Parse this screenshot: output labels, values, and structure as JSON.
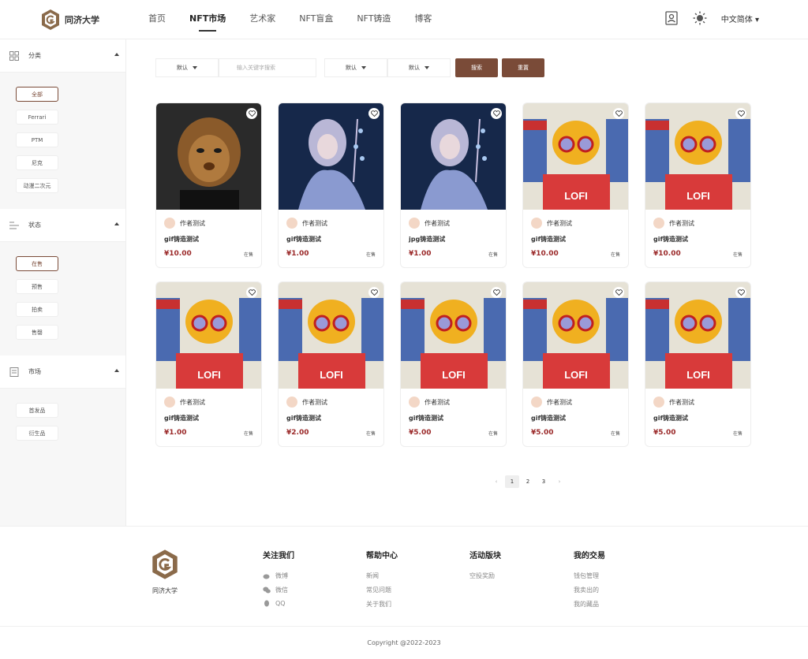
{
  "brand": {
    "name": "同济大学"
  },
  "nav": [
    "首页",
    "NFT市场",
    "艺术家",
    "NFT盲盒",
    "NFT铸造",
    "博客"
  ],
  "header": {
    "language": "中文简体"
  },
  "sidebar": {
    "sections": [
      {
        "title": "分类",
        "chips": [
          "全部",
          "Ferrari",
          "PTM",
          "尼克",
          "动漫二次元"
        ]
      },
      {
        "title": "状态",
        "chips": [
          "在售",
          "预售",
          "拍卖",
          "售罄"
        ]
      },
      {
        "title": "市场",
        "chips": [
          "首发品",
          "衍生品"
        ]
      }
    ]
  },
  "filters": {
    "sort1": "默认",
    "search_placeholder": "输入关键字搜索",
    "sort2": "默认",
    "sort3": "默认",
    "search_button": "搜索",
    "reset_button": "重置"
  },
  "cards": [
    {
      "author": "作者测试",
      "title": "gif铸造测试",
      "price": "¥10.00",
      "status": "在售",
      "art": "lion"
    },
    {
      "author": "作者测试",
      "title": "gif铸造测试",
      "price": "¥1.00",
      "status": "在售",
      "art": "girl"
    },
    {
      "author": "作者测试",
      "title": "jpg铸造测试",
      "price": "¥1.00",
      "status": "在售",
      "art": "girl"
    },
    {
      "author": "作者测试",
      "title": "gif铸造测试",
      "price": "¥10.00",
      "status": "在售",
      "art": "lofi"
    },
    {
      "author": "作者测试",
      "title": "gif铸造测试",
      "price": "¥10.00",
      "status": "在售",
      "art": "lofi"
    },
    {
      "author": "作者测试",
      "title": "gif铸造测试",
      "price": "¥1.00",
      "status": "在售",
      "art": "lofi"
    },
    {
      "author": "作者测试",
      "title": "gif铸造测试",
      "price": "¥2.00",
      "status": "在售",
      "art": "lofi"
    },
    {
      "author": "作者测试",
      "title": "gif铸造测试",
      "price": "¥5.00",
      "status": "在售",
      "art": "lofi"
    },
    {
      "author": "作者测试",
      "title": "gif铸造测试",
      "price": "¥5.00",
      "status": "在售",
      "art": "lofi"
    },
    {
      "author": "作者测试",
      "title": "gif铸造测试",
      "price": "¥5.00",
      "status": "在售",
      "art": "lofi"
    }
  ],
  "lofi_text": "LOFI",
  "pagination": {
    "prev": "‹",
    "pages": [
      "1",
      "2",
      "3"
    ],
    "next": "›",
    "current": "1"
  },
  "footer": {
    "brand": "同济大学",
    "columns": [
      {
        "title": "关注我们",
        "items": [
          "微博",
          "微信",
          "QQ"
        ]
      },
      {
        "title": "帮助中心",
        "items": [
          "新闻",
          "常见问题",
          "关于我们"
        ]
      },
      {
        "title": "活动版块",
        "items": [
          "空投奖励"
        ]
      },
      {
        "title": "我的交易",
        "items": [
          "钱包管理",
          "我卖出的",
          "我的藏品"
        ]
      }
    ],
    "copyright": "Copyright @2022-2023"
  },
  "colors": {
    "accent": "#7a4b38",
    "price": "#9b2a2a"
  }
}
